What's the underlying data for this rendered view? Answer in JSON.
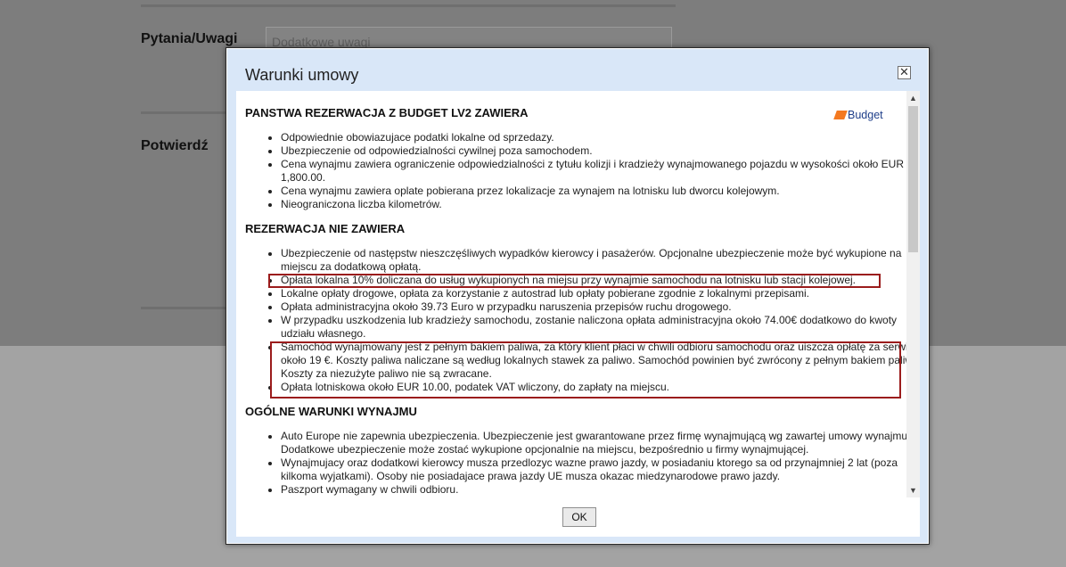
{
  "background": {
    "questions_label": "Pytania/Uwagi",
    "notes_placeholder": "Dodatkowe uwagi",
    "confirm_label": "Potwierdź"
  },
  "modal": {
    "title": "Warunki umowy",
    "close_symbol": "✕",
    "logo_text": "Budget",
    "ok_label": "OK",
    "scroll_up_symbol": "▲",
    "scroll_down_symbol": "▼"
  },
  "sections": [
    {
      "heading": "PANSTWA REZERWACJA Z BUDGET LV2 ZAWIERA",
      "items": [
        "Odpowiednie obowiazujace podatki lokalne od sprzedazy.",
        "Ubezpieczenie od odpowiedzialności cywilnej poza samochodem.",
        "Cena wynajmu zawiera ograniczenie odpowiedzialności z tytułu kolizji i kradzieży wynajmowanego pojazdu w wysokości około EUR 1,800.00.",
        "Cena wynajmu zawiera oplate pobierana przez lokalizacje za wynajem na lotnisku lub dworcu kolejowym.",
        "Nieograniczona liczba kilometrów."
      ]
    },
    {
      "heading": "REZERWACJA NIE ZAWIERA",
      "items": [
        "Ubezpieczenie od następstw nieszczęśliwych wypadków kierowcy i pasażerów. Opcjonalne ubezpieczenie może być wykupione na miejscu za dodatkową opłatą.",
        "Opłata lokalna 10% doliczana do usług wykupionych na miejsu przy wynajmie samochodu na lotnisku lub stacji kolejowej.",
        "Lokalne opłaty drogowe, opłata za korzystanie z autostrad lub opłaty pobierane zgodnie z lokalnymi przepisami.",
        "Opłata administracyjna około 39.73 Euro w przypadku naruszenia przepisów ruchu drogowego.",
        "W przypadku uszkodzenia lub kradzieży samochodu, zostanie naliczona opłata administracyjna około 74.00€ dodatkowo do kwoty udziału własnego.",
        "Samochód wynajmowany jest z pełnym bakiem paliwa, za który klient płaci w chwili odbioru samochodu oraz uiszcza opłatę za serwis około 19 €. Koszty paliwa naliczane są według lokalnych stawek za paliwo. Samochód powinien być zwrócony z pełnym bakiem paliwa. Koszty za niezużyte paliwo nie są zwracane.",
        "Opłata lotniskowa około EUR 10.00, podatek VAT wliczony, do zapłaty na miejscu."
      ]
    },
    {
      "heading": "OGÓLNE WARUNKI WYNAJMU",
      "items": [
        "Auto Europe nie zapewnia ubezpieczenia. Ubezpieczenie jest gwarantowane przez firmę wynajmującą wg zawartej umowy wynajmu. Dodatkowe ubezpieczenie może zostać wykupione opcjonalnie na miejscu, bezpośrednio u firmy wynajmującej.",
        "Wynajmujacy oraz dodatkowi kierowcy musza przedlozyc wazne prawo jazdy, w posiadaniu ktorego sa od przynajmniej 2 lat (poza kilkoma wyjatkami). Osoby nie posiadajace prawa jazdy UE musza okazac miedzynarodowe prawo jazdy.",
        "Paszport wymagany w chwili odbioru."
      ]
    }
  ]
}
